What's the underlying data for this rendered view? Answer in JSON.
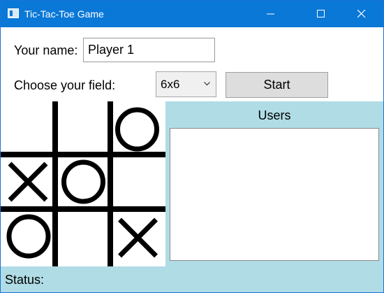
{
  "window": {
    "title": "Tic-Tac-Toe Game",
    "icons": [
      "app-icon",
      "minimize-icon",
      "maximize-icon",
      "close-icon"
    ]
  },
  "form": {
    "name_label": "Your name:",
    "name_value": "Player 1",
    "field_label": "Choose your field:",
    "field_selected": "6x6",
    "start_label": "Start"
  },
  "board": {
    "rows": [
      [
        "",
        "",
        "O"
      ],
      [
        "X",
        "O",
        ""
      ],
      [
        "O",
        "",
        "X"
      ]
    ]
  },
  "users": {
    "title": "Users",
    "items": []
  },
  "status": {
    "label": "Status:",
    "value": ""
  },
  "colors": {
    "titlebar": "#0a78d7",
    "panel": "#b0dce5"
  }
}
